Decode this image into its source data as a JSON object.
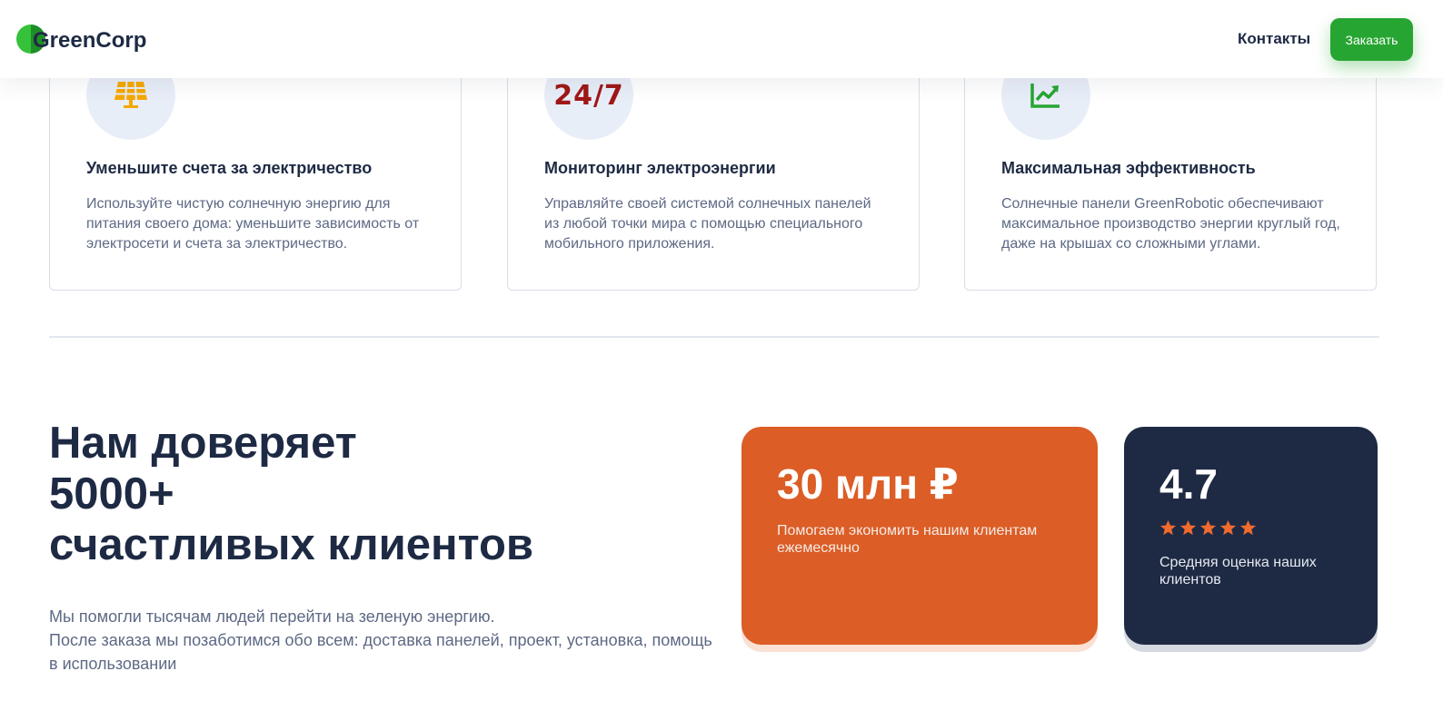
{
  "header": {
    "logo_text": "GreenCorp",
    "nav_contacts": "Контакты",
    "order_button": "Заказать"
  },
  "features": [
    {
      "icon": "solar-panel-icon",
      "title": "Уменьшите счета за электричество",
      "desc": "Используйте чистую солнечную энергию для питания своего дома: уменьшите зависимость от электросети и счета за электричество."
    },
    {
      "icon": "24-7-icon",
      "icon_text": "24/7",
      "title": "Мониторинг электроэнергии",
      "desc": "Управляйте своей системой солнечных панелей из любой точки мира с помощью специального мобильного приложения."
    },
    {
      "icon": "chart-line-icon",
      "title": "Максимальная эффективность",
      "desc": "Солнечные панели GreenRobotic обеспечивают максимальное производство энергии круглый год, даже на крышах со сложными углами."
    }
  ],
  "trust": {
    "title_lines": [
      "Нам доверяет",
      "5000+",
      "счастливых клиентов"
    ],
    "text_lines": [
      "Мы помогли тысячам людей перейти на зеленую энергию.",
      "После заказа мы позаботимся обо всем: доставка панелей, проект, установка, помощь",
      "в использовании"
    ]
  },
  "stats": {
    "savings": {
      "value": "30 млн ₽",
      "caption": "Помогаем экономить нашим клиентам ежемесячно"
    },
    "rating": {
      "value": "4.7",
      "stars": 5,
      "caption": "Средняя оценка наших клиентов"
    }
  },
  "colors": {
    "brand_green": "#27a532",
    "navy": "#1e2a44",
    "orange": "#dc5d26",
    "star": "#f26a2e",
    "icon_yellow": "#f5a800",
    "icon_red": "#a01818"
  }
}
